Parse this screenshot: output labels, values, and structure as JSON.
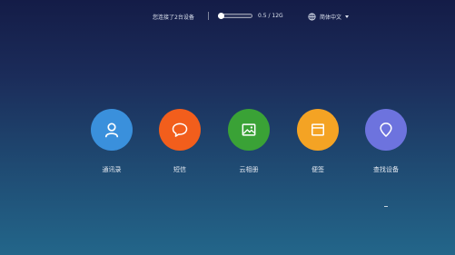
{
  "topbar": {
    "connection_status": "您连接了2台设备",
    "storage": {
      "used_fraction": 0.0,
      "text": "0.5 / 12G"
    },
    "language": {
      "label": "简体中文",
      "icon": "globe-icon",
      "dropdown_icon": "caret-down-icon"
    }
  },
  "apps": [
    {
      "label": "通讯录",
      "icon": "contacts-person-icon",
      "color": "#3a90dc"
    },
    {
      "label": "短信",
      "icon": "chat-bubble-icon",
      "color": "#f25e1c"
    },
    {
      "label": "云相册",
      "icon": "photo-icon",
      "color": "#3aa236"
    },
    {
      "label": "便签",
      "icon": "notes-window-icon",
      "color": "#f4a324"
    },
    {
      "label": "查找设备",
      "icon": "location-pin-icon",
      "color": "#6d73de"
    }
  ],
  "colors": {
    "background_top": "#141c47",
    "background_bottom": "#23668a"
  }
}
